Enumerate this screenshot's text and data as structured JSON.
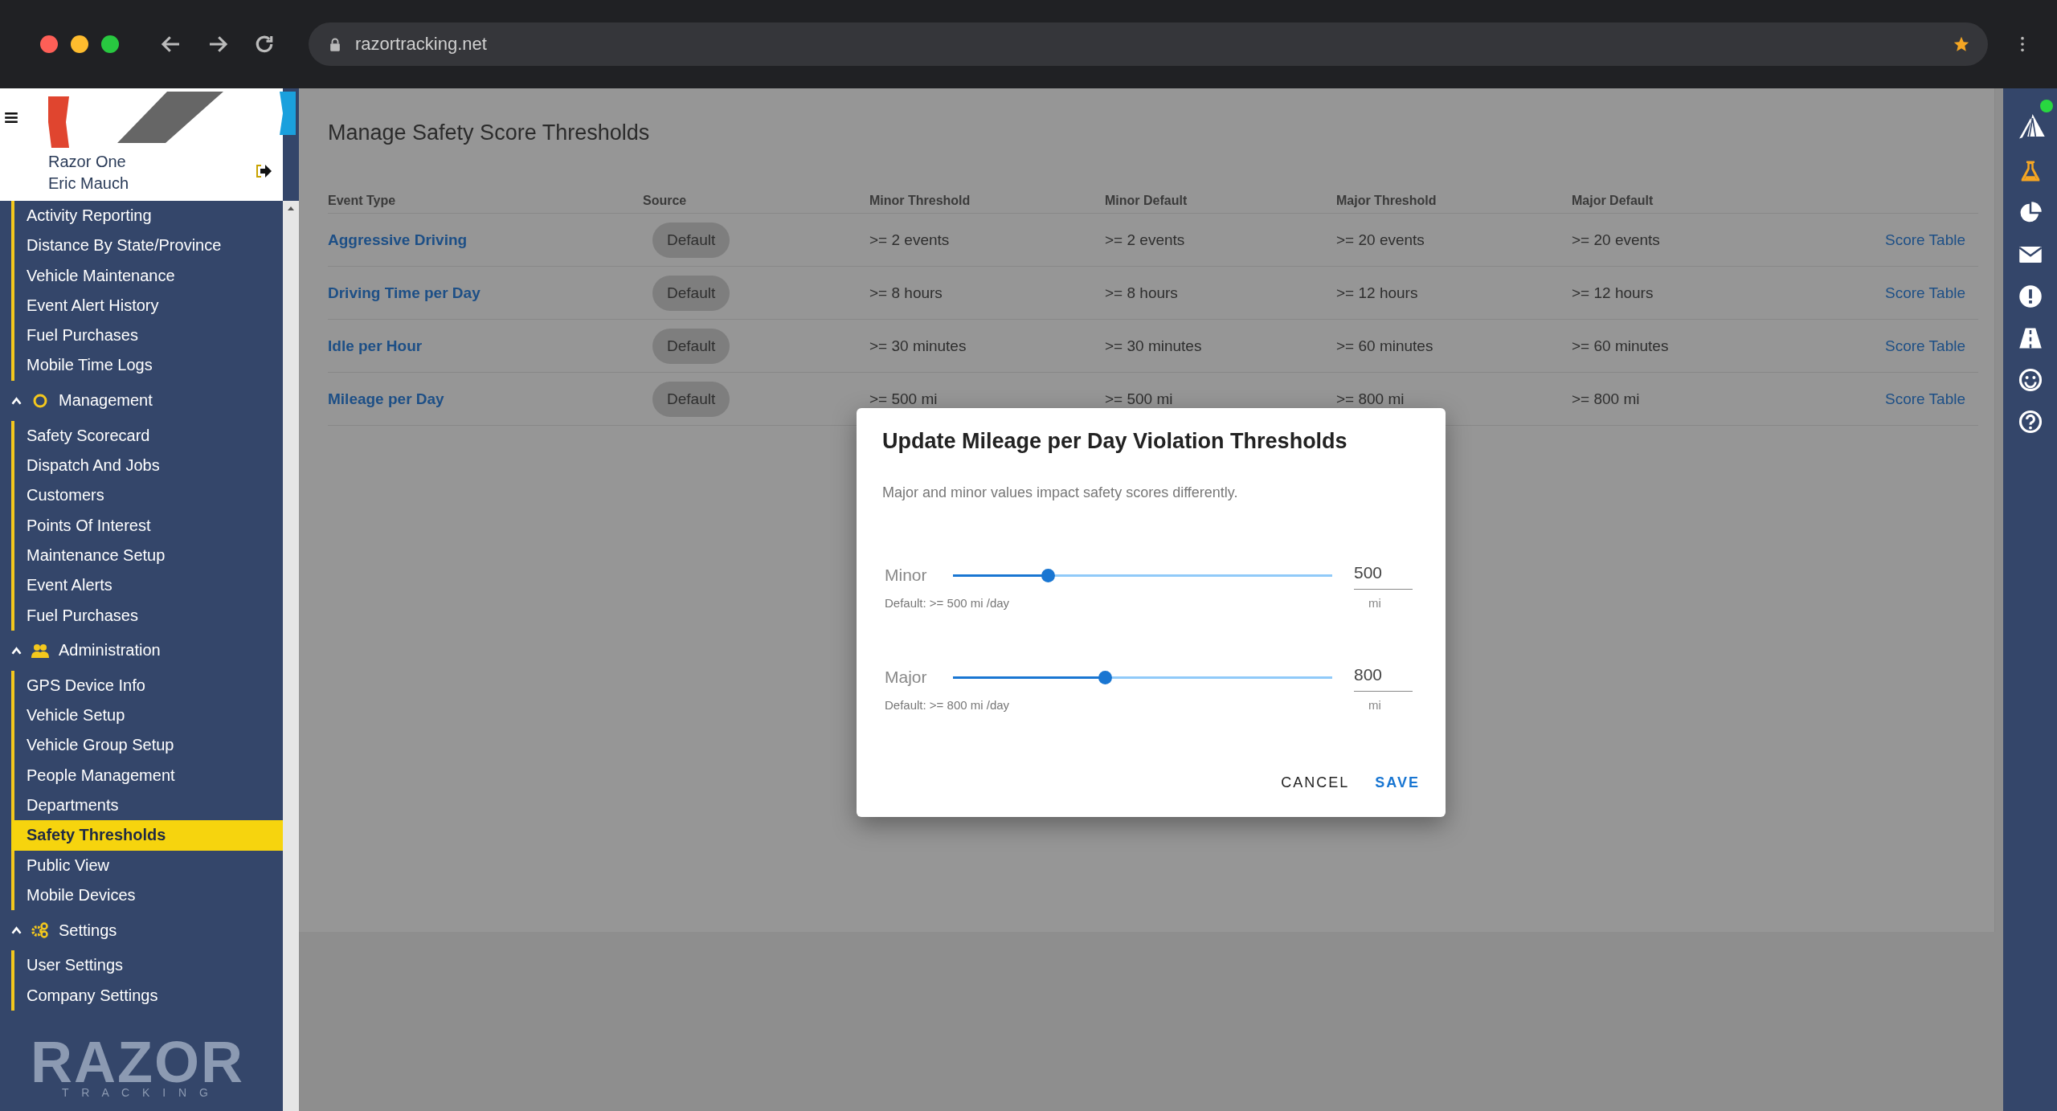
{
  "browser": {
    "url": "razortracking.net"
  },
  "sidebar": {
    "company": "Razor One",
    "user": "Eric Mauch",
    "top_items": [
      {
        "label": "Activity Reporting",
        "selected": false
      },
      {
        "label": "Distance By State/Province",
        "selected": false
      },
      {
        "label": "Vehicle Maintenance",
        "selected": false
      },
      {
        "label": "Event Alert History",
        "selected": false
      },
      {
        "label": "Fuel Purchases",
        "selected": false
      },
      {
        "label": "Mobile Time Logs",
        "selected": false
      }
    ],
    "groups": [
      {
        "label": "Management",
        "expanded": true,
        "items": [
          {
            "label": "Safety Scorecard",
            "selected": false
          },
          {
            "label": "Dispatch And Jobs",
            "selected": false
          },
          {
            "label": "Customers",
            "selected": false
          },
          {
            "label": "Points Of Interest",
            "selected": false
          },
          {
            "label": "Maintenance Setup",
            "selected": false
          },
          {
            "label": "Event Alerts",
            "selected": false
          },
          {
            "label": "Fuel Purchases",
            "selected": false
          }
        ]
      },
      {
        "label": "Administration",
        "expanded": true,
        "items": [
          {
            "label": "GPS Device Info",
            "selected": false
          },
          {
            "label": "Vehicle Setup",
            "selected": false
          },
          {
            "label": "Vehicle Group Setup",
            "selected": false
          },
          {
            "label": "People Management",
            "selected": false
          },
          {
            "label": "Departments",
            "selected": false
          },
          {
            "label": "Safety Thresholds",
            "selected": true
          },
          {
            "label": "Public View",
            "selected": false
          },
          {
            "label": "Mobile Devices",
            "selected": false
          }
        ]
      },
      {
        "label": "Settings",
        "expanded": true,
        "items": [
          {
            "label": "User Settings",
            "selected": false
          },
          {
            "label": "Company Settings",
            "selected": false
          }
        ]
      }
    ],
    "logo": {
      "word": "RAZOR",
      "tagline": "T R A C K I N G"
    }
  },
  "page": {
    "title": "Manage Safety Score Thresholds",
    "columns": [
      "Event Type",
      "Source",
      "Minor Threshold",
      "Minor Default",
      "Major Threshold",
      "Major Default"
    ],
    "rows": [
      {
        "event_type": "Aggressive Driving",
        "source": "Default",
        "minor_threshold": ">= 2 events",
        "minor_default": ">= 2 events",
        "major_threshold": ">= 20 events",
        "major_default": ">= 20 events",
        "link": "Score Table"
      },
      {
        "event_type": "Driving Time per Day",
        "source": "Default",
        "minor_threshold": ">= 8 hours",
        "minor_default": ">= 8 hours",
        "major_threshold": ">= 12 hours",
        "major_default": ">= 12 hours",
        "link": "Score Table"
      },
      {
        "event_type": "Idle per Hour",
        "source": "Default",
        "minor_threshold": ">= 30 minutes",
        "minor_default": ">= 30 minutes",
        "major_threshold": ">= 60 minutes",
        "major_default": ">= 60 minutes",
        "link": "Score Table"
      },
      {
        "event_type": "Mileage per Day",
        "source": "Default",
        "minor_threshold": ">= 500 mi",
        "minor_default": ">= 500 mi",
        "major_threshold": ">= 800 mi",
        "major_default": ">= 800 mi",
        "link": "Score Table"
      }
    ]
  },
  "dialog": {
    "title": "Update Mileage per Day Violation Thresholds",
    "description": "Major and minor values impact safety scores differently.",
    "sliders": [
      {
        "label": "Minor",
        "level": 0.25,
        "value": "500",
        "unit": "mi",
        "default_text": "Default: >= 500 mi /day"
      },
      {
        "label": "Major",
        "level": 0.4,
        "value": "800",
        "unit": "mi",
        "default_text": "Default: >= 800 mi /day"
      }
    ],
    "buttons": [
      {
        "label": "CANCEL",
        "kind": "secondary"
      },
      {
        "label": "SAVE",
        "kind": "primary"
      }
    ]
  },
  "status": {
    "online": true
  }
}
